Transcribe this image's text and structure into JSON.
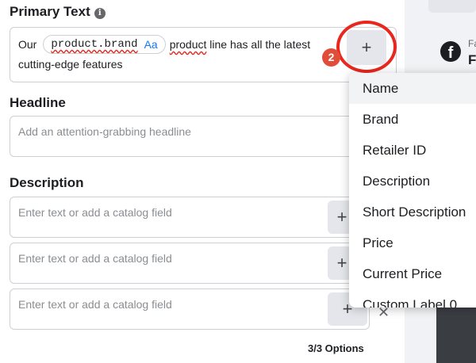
{
  "primary_text": {
    "label": "Primary Text",
    "text_before": "Our",
    "token_field": "product.brand",
    "token_format": "Aa",
    "text_after_word": "product",
    "text_after": " line has all the latest",
    "text_line2": "cutting-edge features"
  },
  "add_button": {
    "label": "+",
    "step_badge": "2"
  },
  "headline": {
    "label": "Headline",
    "placeholder": "Add an attention-grabbing headline"
  },
  "description": {
    "label": "Description",
    "fields": [
      {
        "placeholder": "Enter text or add a catalog field"
      },
      {
        "placeholder": "Enter text or add a catalog field"
      },
      {
        "placeholder": "Enter text or add a catalog field"
      }
    ],
    "add_label": "+",
    "remove_label": "✕",
    "options_count": "3/3 Options"
  },
  "catalog_menu": {
    "items": [
      "Name",
      "Brand",
      "Retailer ID",
      "Description",
      "Short Description",
      "Price",
      "Current Price",
      "Custom Label 0"
    ]
  },
  "preview": {
    "page_initial": "F",
    "page_initial_small": "Fa"
  },
  "colors": {
    "highlight_circle": "#e8271e",
    "badge": "#e04e39",
    "accent": "#1877f2"
  }
}
